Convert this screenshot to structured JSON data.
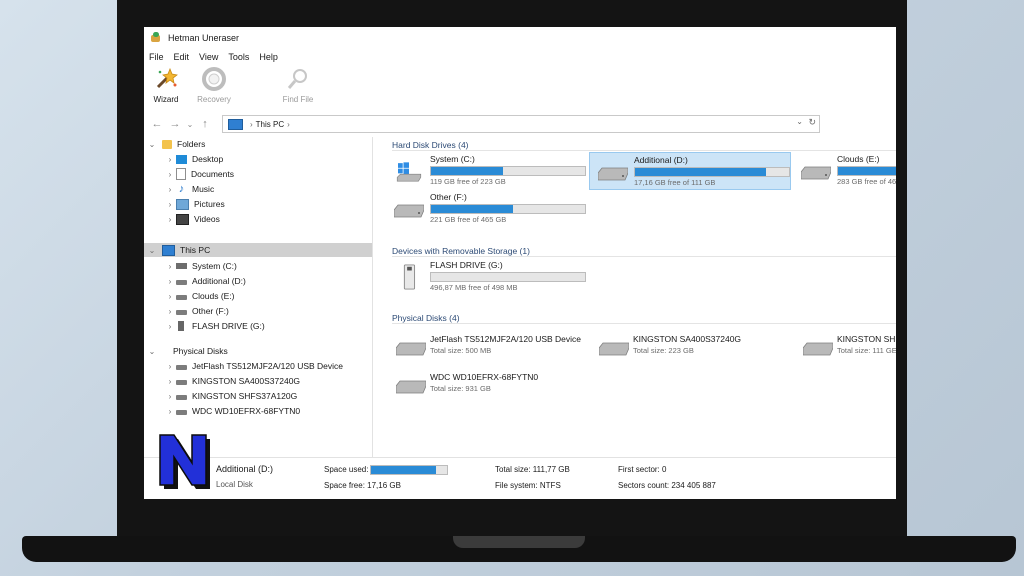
{
  "window": {
    "title": "Hetman Uneraser"
  },
  "menu": [
    "File",
    "Edit",
    "View",
    "Tools",
    "Help"
  ],
  "toolbar": {
    "wizard": "Wizard",
    "recovery": "Recovery",
    "find_file": "Find File"
  },
  "address": {
    "path": "This PC"
  },
  "tree": {
    "folders": {
      "label": "Folders",
      "items": [
        "Desktop",
        "Documents",
        "Music",
        "Pictures",
        "Videos"
      ]
    },
    "this_pc": {
      "label": "This PC",
      "items": [
        "System (C:)",
        "Additional (D:)",
        "Clouds (E:)",
        "Other (F:)",
        "FLASH DRIVE (G:)"
      ]
    },
    "physical": {
      "label": "Physical Disks",
      "items": [
        "JetFlash TS512MJF2A/120 USB Device",
        "KINGSTON SA400S37240G",
        "KINGSTON SHFS37A120G",
        "WDC WD10EFRX-68FYTN0"
      ]
    }
  },
  "pane": {
    "hdd_header": "Hard Disk Drives (4)",
    "hdd": [
      {
        "name": "System (C:)",
        "free": "119 GB free of 223 GB",
        "used_fraction": 0.47
      },
      {
        "name": "Additional (D:)",
        "free": "17,16 GB free of 111 GB",
        "used_fraction": 0.85
      },
      {
        "name": "Clouds (E:)",
        "free": "283 GB free of 46",
        "used_fraction": 0.38
      },
      {
        "name": "Other (F:)",
        "free": "221 GB free of 465 GB",
        "used_fraction": 0.53
      }
    ],
    "removable_header": "Devices with Removable Storage (1)",
    "removable": [
      {
        "name": "FLASH DRIVE (G:)",
        "free": "496,87 MB free of 498 MB",
        "used_fraction": 0.0
      }
    ],
    "physical_header": "Physical Disks (4)",
    "physical": [
      {
        "name": "JetFlash TS512MJF2A/120 USB Device",
        "size": "Total size: 500 MB"
      },
      {
        "name": "KINGSTON SA400S37240G",
        "size": "Total size: 223 GB"
      },
      {
        "name": "KINGSTON SHFS",
        "size": "Total size: 111 GE"
      },
      {
        "name": "WDC WD10EFRX-68FYTN0",
        "size": "Total size: 931 GB"
      }
    ]
  },
  "status": {
    "drive_name": "Additional (D:)",
    "drive_type": "Local Disk",
    "space_used_label": "Space used:",
    "space_used_fraction": 0.85,
    "space_free": "Space free: 17,16 GB",
    "total_size": "Total size: 111,77 GB",
    "file_system": "File system: NTFS",
    "first_sector": "First sector: 0",
    "sectors_count": "Sectors count: 234 405 887"
  },
  "colors": {
    "accent": "#2a8bd6",
    "selection": "#cce4f7",
    "logo_blue": "#2230d8"
  }
}
